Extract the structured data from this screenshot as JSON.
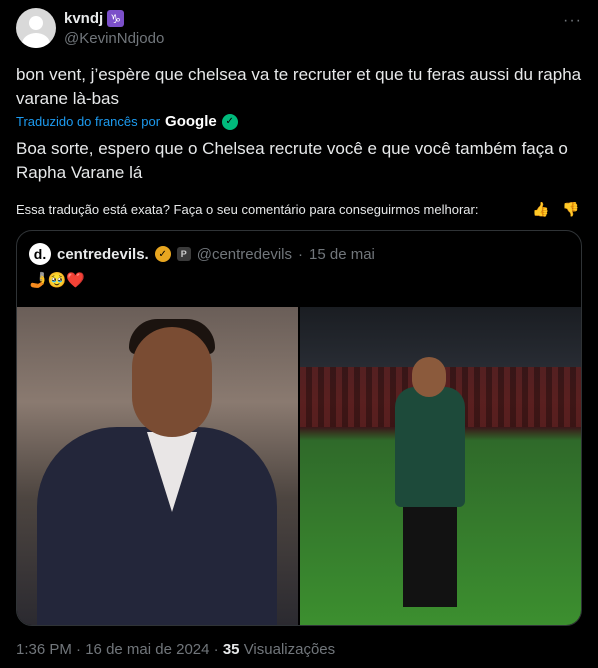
{
  "author": {
    "display_name": "kvndj",
    "badge_icon": "capricorn-icon",
    "badge_glyph": "♑",
    "handle": "@KevinNdjodo"
  },
  "more_glyph": "···",
  "tweet": {
    "original_text": "bon vent, j’espère que chelsea va te recruter et que tu feras aussi du rapha varane là-bas",
    "translated_by_label": "Traduzido do francês por",
    "translator_brand": "Google",
    "translation_text": "Boa sorte, espero que o Chelsea recrute você e que você também faça o Rapha Varane lá"
  },
  "feedback": {
    "question": "Essa tradução está exata? Faça o seu comentário para conseguirmos melhorar:",
    "thumbs_up": "👍",
    "thumbs_down": "👎"
  },
  "quote": {
    "avatar_letter": "d.",
    "name": "centredevils.",
    "affiliate_badge": "P",
    "handle": "@centredevils",
    "separator": "·",
    "date": "15 de mai",
    "emojis": "🤳🥹❤️"
  },
  "meta": {
    "time": "1:36 PM",
    "dot1": "·",
    "date": "16 de mai de 2024",
    "dot2": "·",
    "views_count": "35",
    "views_label": "Visualizações"
  },
  "colors": {
    "background": "#000000",
    "text": "#e7e9ea",
    "muted": "#71767b",
    "link": "#1d9bf0",
    "border": "#2f3336"
  }
}
